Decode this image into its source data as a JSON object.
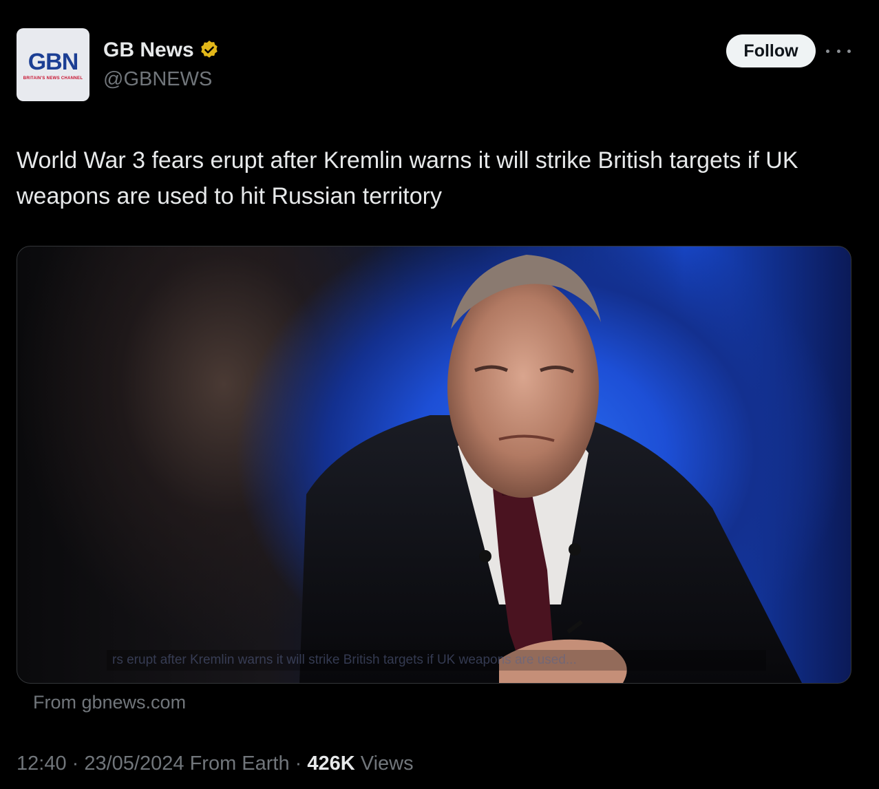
{
  "author": {
    "display_name": "GB News",
    "handle": "@GBNEWS",
    "avatar_logo_text": "GBN",
    "avatar_tagline": "BRITAIN'S NEWS CHANNEL",
    "verified_color": "#e2b719"
  },
  "actions": {
    "follow_label": "Follow",
    "more_icon": "more-horizontal-icon"
  },
  "tweet": {
    "text": "World War 3 fears erupt after Kremlin warns it will strike British targets if UK weapons are used to hit Russian territory",
    "media_caption": "rs erupt after Kremlin warns it will strike British targets if UK weapons are used...",
    "source": "From gbnews.com"
  },
  "meta": {
    "time": "12:40",
    "sep1": " · ",
    "date": "23/05/2024",
    "location": " From Earth",
    "sep2": " · ",
    "views_count": "426K",
    "views_label": " Views"
  },
  "colors": {
    "background": "#000000",
    "text_primary": "#e7e9ea",
    "text_secondary": "#71767b",
    "follow_bg": "#eff3f4"
  }
}
